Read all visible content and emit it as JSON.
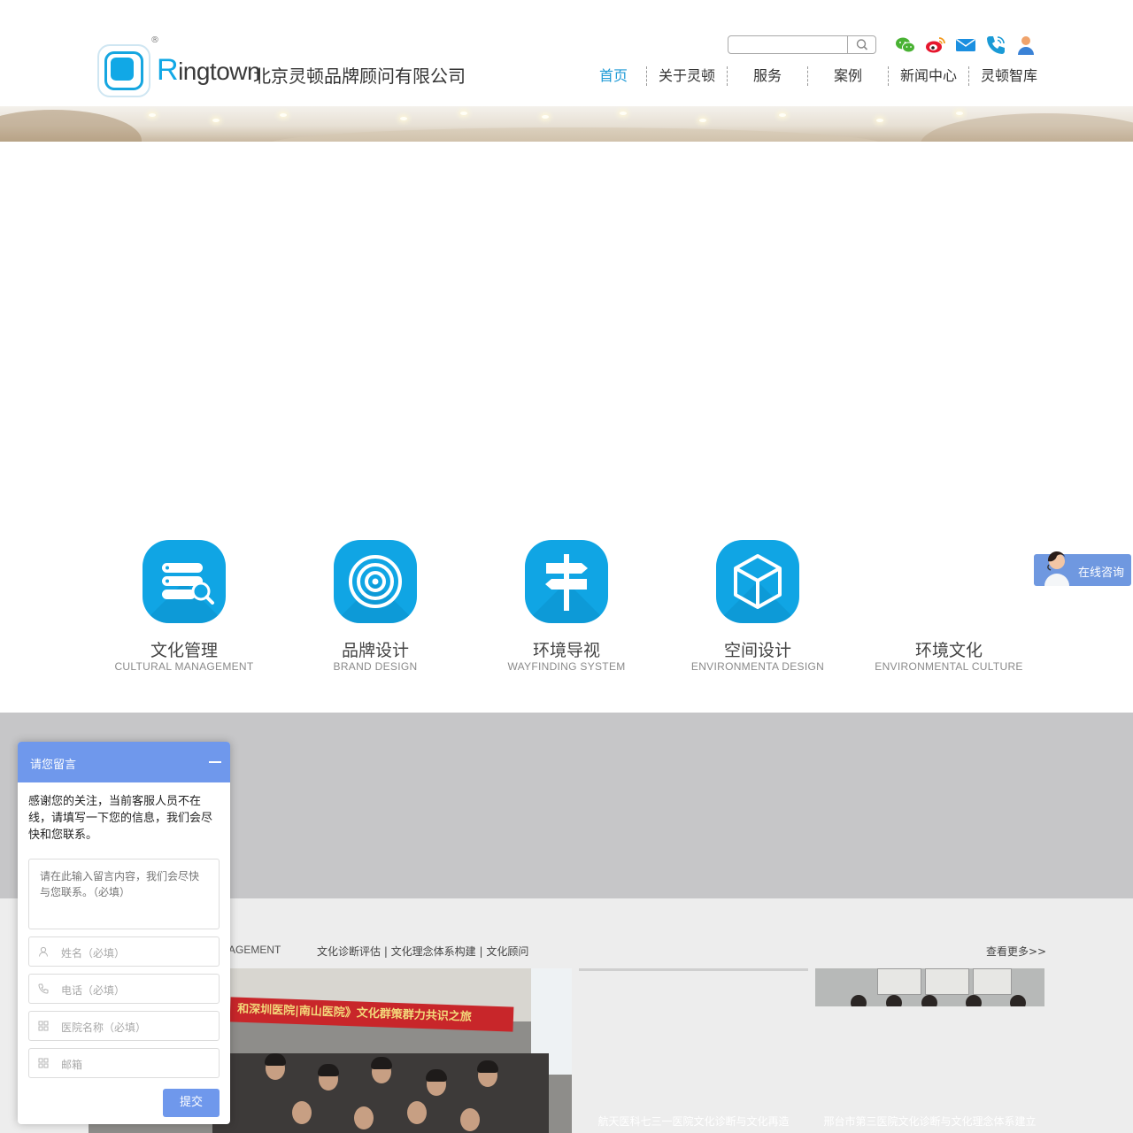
{
  "brand": {
    "registered": "®",
    "name_initial": "R",
    "name_rest": "ingtown",
    "name_cn": "北京灵顿品牌顾问有限公司"
  },
  "search": {
    "value": "",
    "placeholder": ""
  },
  "social_icons": [
    "wechat-icon",
    "weibo-icon",
    "mail-icon",
    "phone-icon",
    "user-icon"
  ],
  "nav": {
    "items": [
      {
        "label": "首页",
        "active": true
      },
      {
        "label": "关于灵顿"
      },
      {
        "label": "服务"
      },
      {
        "label": "案例"
      },
      {
        "label": "新闻中心"
      },
      {
        "label": "灵顿智库"
      }
    ]
  },
  "services": [
    {
      "title": "文化管理",
      "subtitle": "CULTURAL MANAGEMENT",
      "icon": "database-search-icon"
    },
    {
      "title": "品牌设计",
      "subtitle": "BRAND DESIGN",
      "icon": "target-icon"
    },
    {
      "title": "环境导视",
      "subtitle": "WAYFINDING SYSTEM",
      "icon": "signpost-icon"
    },
    {
      "title": "空间设计",
      "subtitle": "ENVIRONMENTA DESIGN",
      "icon": "cube-icon"
    },
    {
      "title": "环境文化",
      "subtitle": "ENVIRONMENTAL CULTURE"
    }
  ],
  "section": {
    "heading_en_partial": "AGEMENT",
    "links": "文化诊断评估 | 文化理念体系构建 | 文化顾问",
    "more": "查看更多>>"
  },
  "photo_banner_text": "和深圳医院|南山医院》文化群策群力共识之旅",
  "cards": [
    {
      "caption": "航天医科七三一医院文化诊断与文化再造"
    },
    {
      "caption": "邢台市第三医院文化诊断与文化理念体系建立"
    }
  ],
  "consult": {
    "label": "在线咨询"
  },
  "message_widget": {
    "title": "请您留言",
    "intro": "感谢您的关注，当前客服人员不在线，请填写一下您的信息，我们会尽快和您联系。",
    "textarea_placeholder": "请在此输入留言内容，我们会尽快与您联系。（必填）",
    "fields": [
      {
        "placeholder": "姓名（必填）",
        "icon": "user-icon"
      },
      {
        "placeholder": "电话（必填）",
        "icon": "phone-icon"
      },
      {
        "placeholder": "医院名称（必填）",
        "icon": "grid-icon"
      },
      {
        "placeholder": "邮箱",
        "icon": "grid-icon"
      }
    ],
    "submit": "提交"
  },
  "colors": {
    "accent": "#10a5e4",
    "nav_active": "#1e9ad6",
    "widget": "#6f98ec",
    "gray_band": "#c6c6c8"
  }
}
